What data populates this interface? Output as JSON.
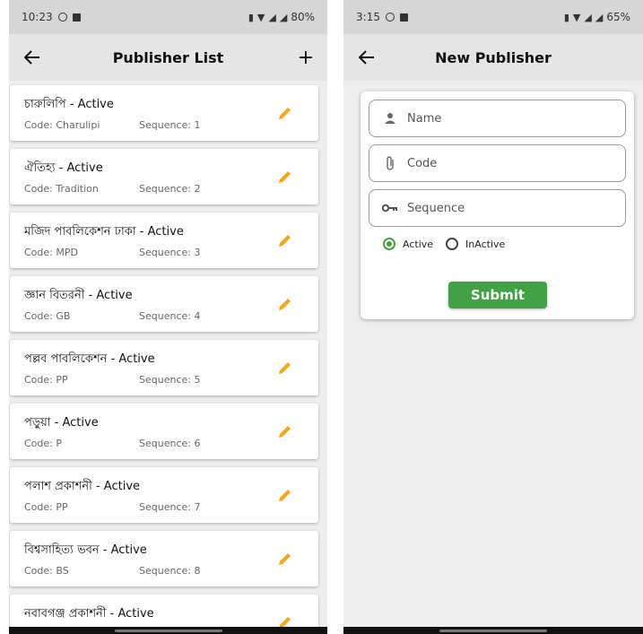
{
  "colors": {
    "accent_green": "#43a047",
    "edit_orange": "#f5a623",
    "appbar": "#e5e5e5",
    "statusbar": "#d6d6d6"
  },
  "left_screen": {
    "status": {
      "time": "10:23",
      "battery": "80%"
    },
    "appbar": {
      "title": "Publisher List",
      "back_icon": "arrow-left-icon",
      "add_label": "+"
    },
    "publishers": [
      {
        "name": "চারুলিপি - Active",
        "code": "Code: Charulipi",
        "sequence": "Sequence: 1"
      },
      {
        "name": "ঐতিহ্য - Active",
        "code": "Code: Tradition",
        "sequence": "Sequence: 2"
      },
      {
        "name": "মজিদ পাবলিকেশন ঢাকা - Active",
        "code": "Code: MPD",
        "sequence": "Sequence: 3"
      },
      {
        "name": "জ্ঞান বিতরনী - Active",
        "code": "Code: GB",
        "sequence": "Sequence: 4"
      },
      {
        "name": "পল্লব পাবলিকেশন - Active",
        "code": "Code: PP",
        "sequence": "Sequence: 5"
      },
      {
        "name": "পড়ুয়া - Active",
        "code": "Code: P",
        "sequence": "Sequence: 6"
      },
      {
        "name": "পলাশ প্রকাশনী - Active",
        "code": "Code: PP",
        "sequence": "Sequence: 7"
      },
      {
        "name": "বিশ্বসাহিত্য ভবন - Active",
        "code": "Code: BS",
        "sequence": "Sequence: 8"
      },
      {
        "name": "নবাবগঞ্জ প্রকাশনী - Active",
        "code": "",
        "sequence": ""
      }
    ]
  },
  "right_screen": {
    "status": {
      "time": "3:15",
      "battery": "65%"
    },
    "appbar": {
      "title": "New Publisher",
      "back_icon": "arrow-left-icon"
    },
    "form": {
      "name_placeholder": "Name",
      "code_placeholder": "Code",
      "sequence_placeholder": "Sequence",
      "radio_active": "Active",
      "radio_inactive": "InActive",
      "selected_status": "Active",
      "submit_label": "Submit"
    }
  }
}
